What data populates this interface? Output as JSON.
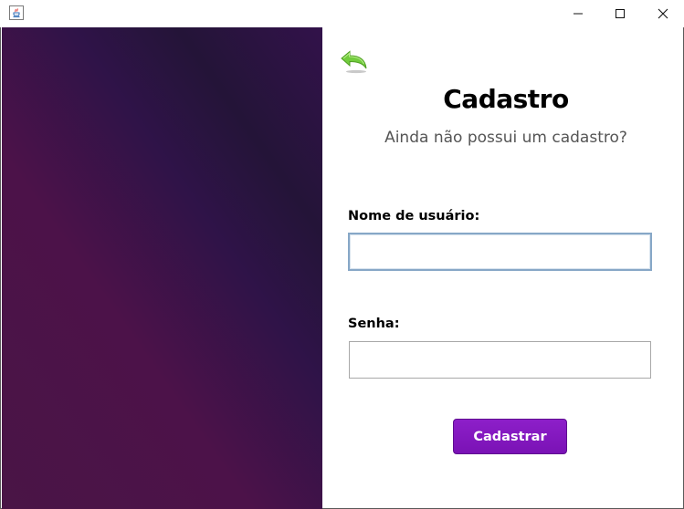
{
  "window": {
    "title": "",
    "controls": [
      "minimize",
      "maximize",
      "close"
    ]
  },
  "form": {
    "title": "Cadastro",
    "subtitle": "Ainda não possui um cadastro?",
    "username_label": "Nome de usuário:",
    "username_value": "",
    "password_label": "Senha:",
    "password_value": "",
    "submit_label": "Cadastrar"
  },
  "icons": {
    "app": "java-icon",
    "back": "back-arrow-icon"
  },
  "colors": {
    "panel_gradient_start": "#4c1249",
    "panel_gradient_end": "#241438",
    "button": "#8d1fc9",
    "back_arrow": "#6fc93a"
  }
}
